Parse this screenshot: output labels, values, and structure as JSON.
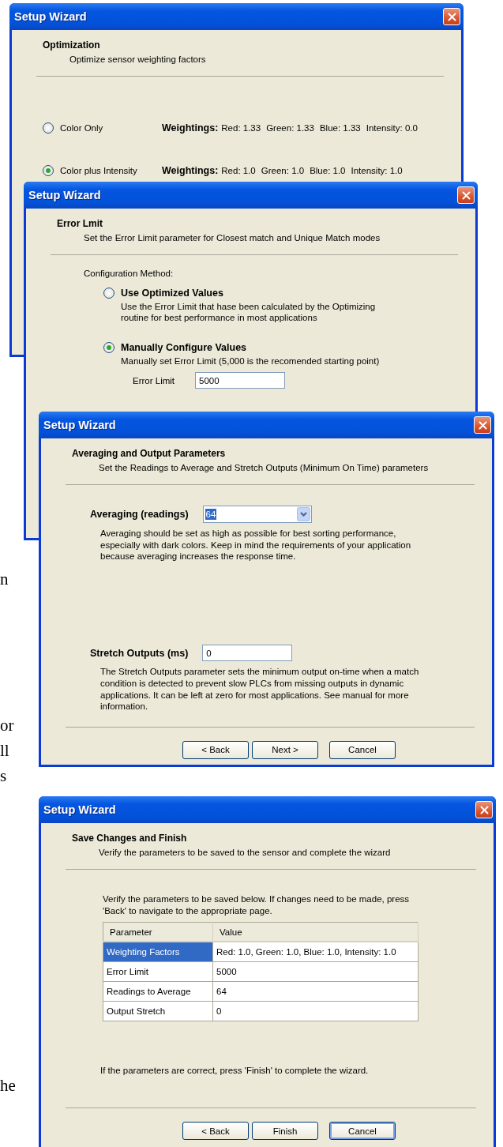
{
  "background_text": [
    "n",
    "or",
    "ll",
    "s",
    "he"
  ],
  "windows": [
    {
      "kind": "options",
      "title": "Setup Wizard",
      "heading": "Optimization",
      "subheading": "Optimize sensor weighting factors",
      "options": [
        {
          "label": "Color Only",
          "selected": false,
          "weightings_label": "Weightings:",
          "values": [
            "Red: 1.33",
            "Green: 1.33",
            "Blue: 1.33",
            "Intensity: 0.0"
          ]
        },
        {
          "label": "Color plus Intensity",
          "selected": true,
          "weightings_label": "Weightings:",
          "values": [
            "Red: 1.0",
            "Green: 1.0",
            "Blue: 1.0",
            "Intensity: 1.0"
          ]
        }
      ]
    },
    {
      "kind": "method",
      "title": "Setup Wizard",
      "heading": "Error Lmit",
      "subheading": "Set the Error Limit parameter for Closest match and Unique Match modes",
      "section_label": "Configuration Method:",
      "options": [
        {
          "label": "Use Optimized Values",
          "selected": false,
          "description": "Use the Error Limit that hase been calculated by the Optimizing routine for best performance in most applications"
        },
        {
          "label": "Manually Configure Values",
          "selected": true,
          "description": "Manually set Error Limit (5,000 is the recomended starting point)",
          "field": {
            "label": "Error Limit",
            "value": "5000"
          }
        }
      ]
    },
    {
      "kind": "parameters",
      "title": "Setup Wizard",
      "heading": "Averaging and Output Parameters",
      "subheading": "Set the Readings to Average and Stretch Outputs (Minimum On Time) parameters",
      "fields": [
        {
          "kind": "dropdown",
          "label": "Averaging (readings)",
          "value": "64",
          "text_selected": true,
          "description": "Averaging should be set as high as possible for best sorting performance, especially with dark colors. Keep in mind the requirements of your application because averaging increases the response time."
        },
        {
          "kind": "text",
          "label": "Stretch Outputs (ms)",
          "value": "0",
          "description": "The Stretch Outputs parameter sets the minimum output on-time when a match condition is detected to prevent slow PLCs from missing outputs in dynamic applications. It can be left at zero for most applications. See manual for more information."
        }
      ],
      "buttons": [
        {
          "kind": "back",
          "label": "< Back",
          "default": false
        },
        {
          "kind": "next",
          "label": "Next >",
          "default": false
        },
        {
          "kind": "cancel",
          "label": "Cancel",
          "default": false
        }
      ]
    },
    {
      "kind": "summary",
      "title": "Setup Wizard",
      "heading": "Save Changes and Finish",
      "subheading": "Verify the parameters to be saved to the sensor and complete the wizard",
      "intro": "Verify the parameters to be saved below. If changes need to be made, press 'Back' to navigate to the appropriate page.",
      "table": {
        "columns": [
          "Parameter",
          "Value"
        ],
        "rows": [
          {
            "cells": [
              "Weighting Factors",
              "Red: 1.0, Green: 1.0, Blue: 1.0, Intensity: 1.0"
            ],
            "selected": true
          },
          {
            "cells": [
              "Error Limit",
              "5000"
            ],
            "selected": false
          },
          {
            "cells": [
              "Readings to Average",
              "64"
            ],
            "selected": false
          },
          {
            "cells": [
              "Output Stretch",
              "0"
            ],
            "selected": false
          }
        ]
      },
      "note": "If the parameters are correct, press 'Finish' to complete the wizard.",
      "buttons": [
        {
          "kind": "back",
          "label": "< Back",
          "default": false
        },
        {
          "kind": "finish",
          "label": "Finish",
          "default": false
        },
        {
          "kind": "cancel",
          "label": "Cancel",
          "default": true
        }
      ]
    }
  ]
}
